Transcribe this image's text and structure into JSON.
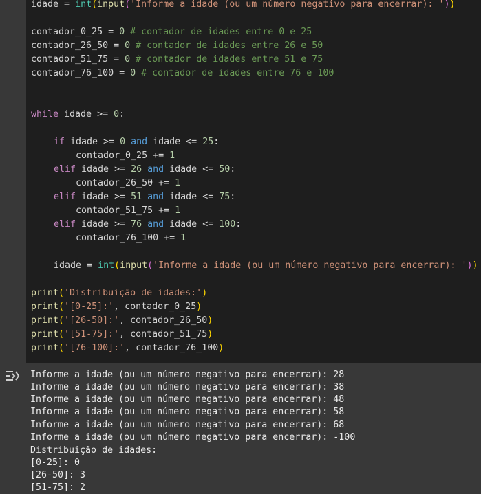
{
  "code": {
    "line_idade_input": {
      "var": "idade",
      "op": " = ",
      "int": "int",
      "p1": "(",
      "input": "input",
      "p2": "(",
      "prompt": "'Informe a idade (ou um número negativo para encerrar): '",
      "p3": ")",
      "p4": ")"
    },
    "counters": [
      {
        "name": "contador_0_25",
        "assign": " = ",
        "zero": "0",
        "comment": " # contador de idades entre 0 e 25"
      },
      {
        "name": "contador_26_50",
        "assign": " = ",
        "zero": "0",
        "comment": " # contador de idades entre 26 e 50"
      },
      {
        "name": "contador_51_75",
        "assign": " = ",
        "zero": "0",
        "comment": " # contador de idades entre 51 e 75"
      },
      {
        "name": "contador_76_100",
        "assign": " = ",
        "zero": "0",
        "comment": " # contador de idades entre 76 e 100"
      }
    ],
    "while_line": {
      "kw": "while",
      "rest": " idade >= ",
      "num": "0",
      "colon": ":"
    },
    "branches": [
      {
        "kw": "if",
        "a": " idade >= ",
        "lo": "0",
        "and": "and",
        "b": " idade <= ",
        "hi": "25",
        "colon": ":",
        "body_var": "contador_0_25",
        "body_op": " += ",
        "body_num": "1"
      },
      {
        "kw": "elif",
        "a": " idade >= ",
        "lo": "26",
        "and": "and",
        "b": " idade <= ",
        "hi": "50",
        "colon": ":",
        "body_var": "contador_26_50",
        "body_op": " += ",
        "body_num": "1"
      },
      {
        "kw": "elif",
        "a": " idade >= ",
        "lo": "51",
        "and": "and",
        "b": " idade <= ",
        "hi": "75",
        "colon": ":",
        "body_var": "contador_51_75",
        "body_op": " += ",
        "body_num": "1"
      },
      {
        "kw": "elif",
        "a": " idade >= ",
        "lo": "76",
        "and": "and",
        "b": " idade <= ",
        "hi": "100",
        "colon": ":",
        "body_var": "contador_76_100",
        "body_op": " += ",
        "body_num": "1"
      }
    ],
    "prints": [
      {
        "fn": "print",
        "open": "(",
        "str": "'Distribuição de idades:'",
        "sep": "",
        "arg": "",
        "close": ")"
      },
      {
        "fn": "print",
        "open": "(",
        "str": "'[0-25]:'",
        "sep": ", ",
        "arg": "contador_0_25",
        "close": ")"
      },
      {
        "fn": "print",
        "open": "(",
        "str": "'[26-50]:'",
        "sep": ", ",
        "arg": "contador_26_50",
        "close": ")"
      },
      {
        "fn": "print",
        "open": "(",
        "str": "'[51-75]:'",
        "sep": ", ",
        "arg": "contador_51_75",
        "close": ")"
      },
      {
        "fn": "print",
        "open": "(",
        "str": "'[76-100]:'",
        "sep": ", ",
        "arg": "contador_76_100",
        "close": ")"
      }
    ]
  },
  "output": {
    "icon": "output-toggle-icon",
    "lines": [
      "Informe a idade (ou um número negativo para encerrar): 28",
      "Informe a idade (ou um número negativo para encerrar): 38",
      "Informe a idade (ou um número negativo para encerrar): 48",
      "Informe a idade (ou um número negativo para encerrar): 58",
      "Informe a idade (ou um número negativo para encerrar): 68",
      "Informe a idade (ou um número negativo para encerrar): -100",
      "Distribuição de idades:",
      "[0-25]: 0",
      "[26-50]: 3",
      "[51-75]: 2"
    ]
  },
  "colors": {
    "editor_bg": "#1e1e1e",
    "panel_bg": "#383838",
    "keyword": "#c586c0",
    "string": "#ce9178",
    "number": "#b5cea8",
    "comment": "#6a9955"
  }
}
